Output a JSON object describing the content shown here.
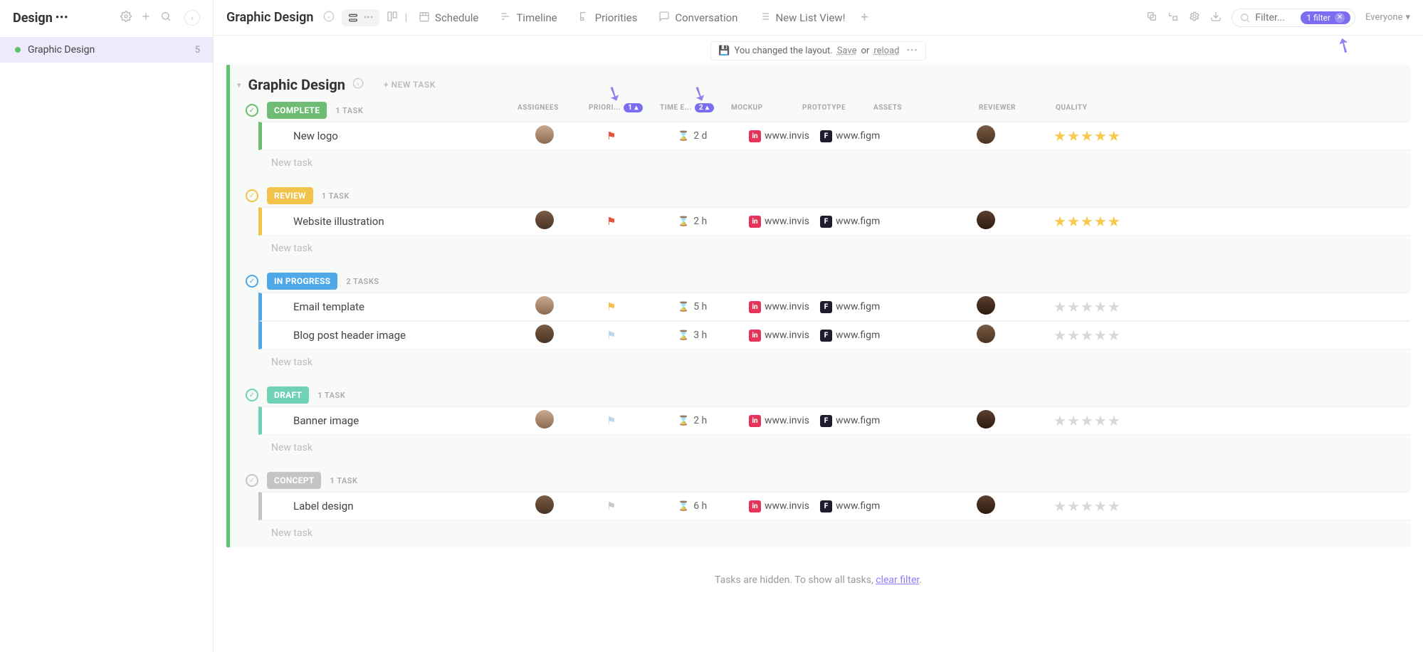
{
  "sidebar": {
    "title": "Design",
    "dots": "•••",
    "items": [
      {
        "label": "Graphic Design",
        "count": "5"
      }
    ]
  },
  "topbar": {
    "breadcrumb": "Graphic Design",
    "tabs": [
      {
        "label": "Schedule"
      },
      {
        "label": "Timeline"
      },
      {
        "label": "Priorities"
      },
      {
        "label": "Conversation"
      },
      {
        "label": "New List View!"
      }
    ],
    "filter": {
      "placeholder": "Filter...",
      "pill": "1 filter"
    },
    "everyone": "Everyone"
  },
  "notice": {
    "text": "You changed the layout.",
    "save": "Save",
    "or": "or",
    "reload": "reload"
  },
  "section": {
    "title": "Graphic Design",
    "new_task": "+ NEW TASK"
  },
  "columns": {
    "assignees": "ASSIGNEES",
    "priority": "PRIORI...",
    "priority_badge": "1",
    "time": "TIME E...",
    "time_badge": "2",
    "mockup": "MOCKUP",
    "prototype": "PROTOTYPE",
    "assets": "ASSETS",
    "reviewer": "REVIEWER",
    "quality": "QUALITY"
  },
  "groups": [
    {
      "status": "COMPLETE",
      "color": "#6fbd74",
      "count": "1 TASK",
      "tasks": [
        {
          "title": "New logo",
          "flag": "#e84d3d",
          "time": "2 d",
          "mockup": "www.invis",
          "proto": "www.figm",
          "stars": 5,
          "filled": true,
          "av": "av1",
          "rv": "av2"
        }
      ]
    },
    {
      "status": "REVIEW",
      "color": "#f2c34b",
      "count": "1 TASK",
      "tasks": [
        {
          "title": "Website illustration",
          "flag": "#e84d3d",
          "time": "2 h",
          "mockup": "www.invis",
          "proto": "www.figm",
          "stars": 5,
          "filled": true,
          "av": "av2",
          "rv": "av3"
        }
      ]
    },
    {
      "status": "IN PROGRESS",
      "color": "#4fa8e8",
      "count": "2 TASKS",
      "tasks": [
        {
          "title": "Email template",
          "flag": "#f3c14b",
          "time": "5 h",
          "mockup": "www.invis",
          "proto": "www.figm",
          "stars": 5,
          "filled": false,
          "av": "av1",
          "rv": "av3"
        },
        {
          "title": "Blog post header image",
          "flag": "#b9d8f0",
          "time": "3 h",
          "mockup": "www.invis",
          "proto": "www.figm",
          "stars": 5,
          "filled": false,
          "av": "av2",
          "rv": "av2"
        }
      ]
    },
    {
      "status": "DRAFT",
      "color": "#6fd1b5",
      "count": "1 TASK",
      "tasks": [
        {
          "title": "Banner image",
          "flag": "#b9d8f0",
          "time": "2 h",
          "mockup": "www.invis",
          "proto": "www.figm",
          "stars": 5,
          "filled": false,
          "av": "av1",
          "rv": "av3"
        }
      ]
    },
    {
      "status": "CONCEPT",
      "color": "#c4c4c4",
      "count": "1 TASK",
      "tasks": [
        {
          "title": "Label design",
          "flag": "#c9c9c9",
          "time": "6 h",
          "mockup": "www.invis",
          "proto": "www.figm",
          "stars": 5,
          "filled": false,
          "av": "av2",
          "rv": "av3"
        }
      ]
    }
  ],
  "new_task_label": "New task",
  "hidden_msg": {
    "pre": "Tasks are hidden. To show all tasks, ",
    "link": "clear filter",
    "post": "."
  },
  "apps": {
    "invis_bg": "#e6335a",
    "invis_txt": "in",
    "figma_bg": "#1e1e2e",
    "figma_txt": "F"
  }
}
